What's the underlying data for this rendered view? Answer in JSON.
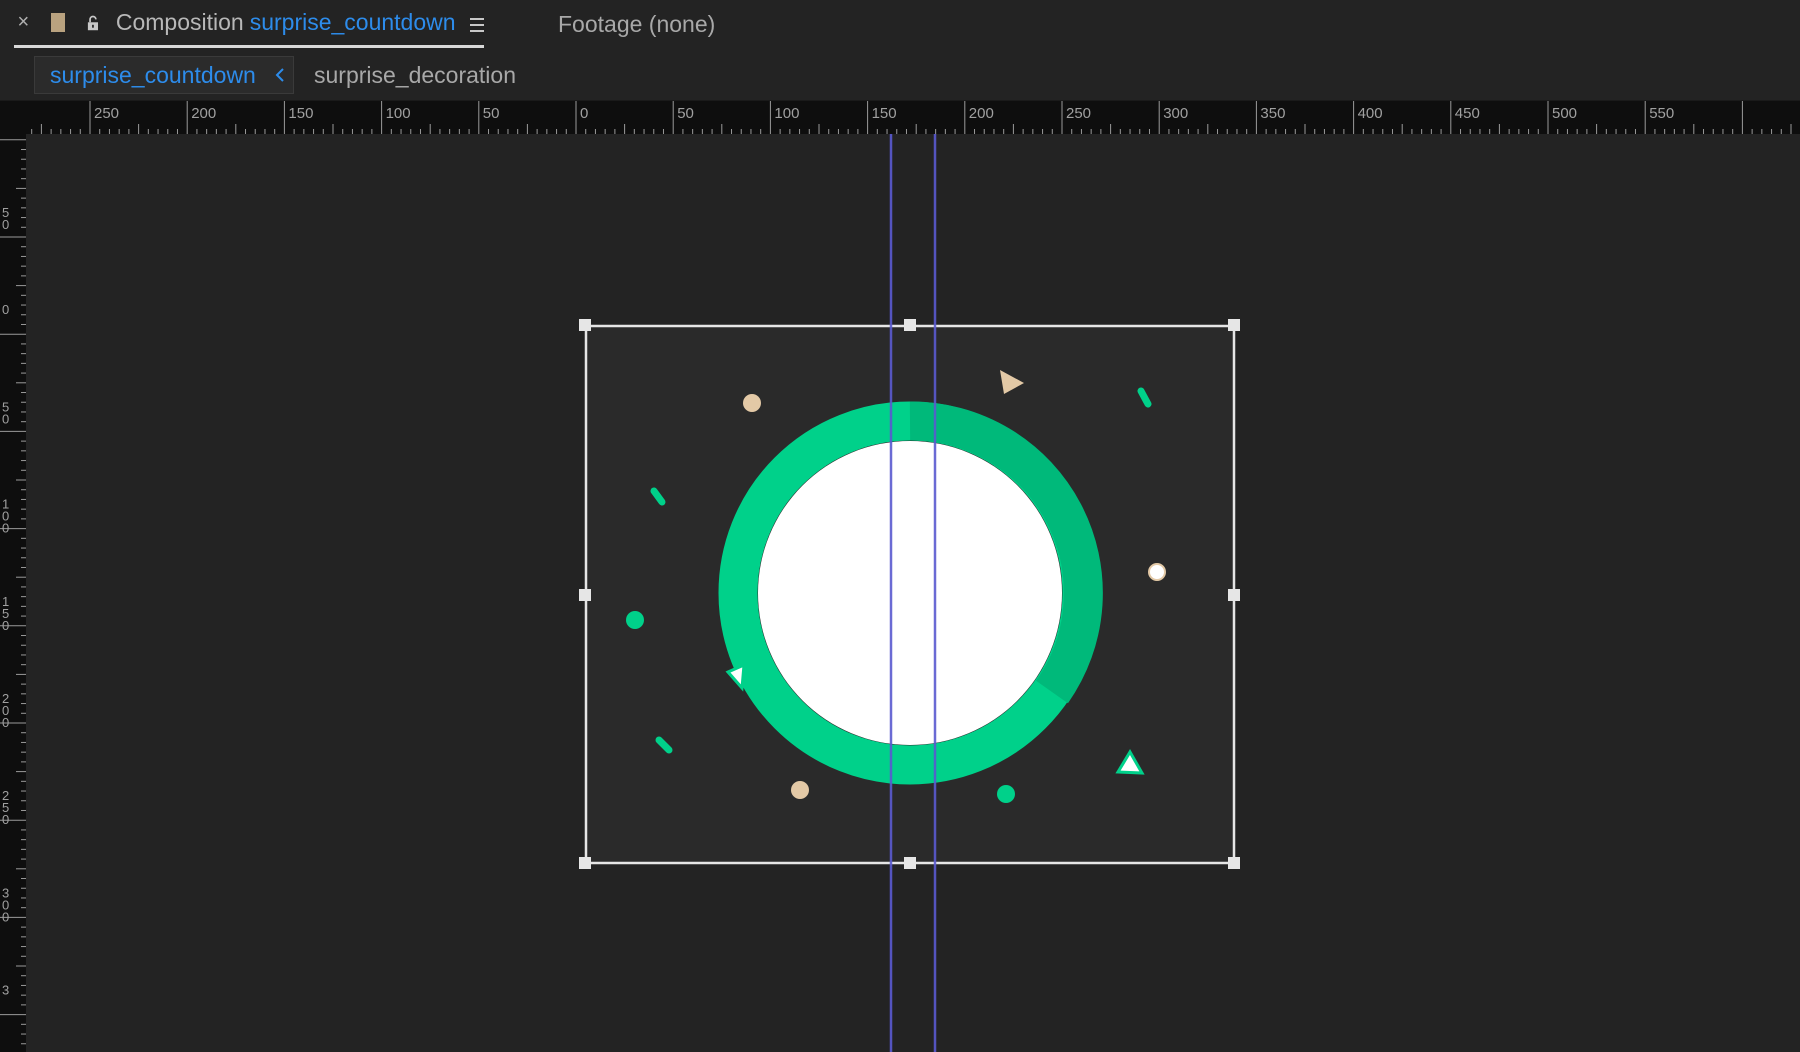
{
  "panel": {
    "close_glyph": "×",
    "composition_tab": {
      "prefix": "Composition",
      "name": "surprise_countdown",
      "swatch_color": "#b9a27f",
      "lock_icon": "lock-open-icon",
      "menu_icon": "hamburger-icon"
    },
    "footage_tab": {
      "label": "Footage (none)"
    }
  },
  "breadcrumbs": {
    "active": "surprise_countdown",
    "arrow_icon": "chevron-left-icon",
    "next": "surprise_decoration"
  },
  "ruler": {
    "horizontal_labels": [
      "250",
      "200",
      "150",
      "100",
      "50",
      "0",
      "50",
      "100",
      "150",
      "200",
      "250",
      "300",
      "350",
      "400",
      "450",
      "500",
      "550"
    ],
    "vertical_labels": [
      [
        "5",
        "0"
      ],
      [
        "0"
      ],
      [
        "5",
        "0"
      ],
      [
        "1",
        "0",
        "0"
      ],
      [
        "1",
        "5",
        "0"
      ],
      [
        "2",
        "0",
        "0"
      ],
      [
        "2",
        "5",
        "0"
      ],
      [
        "3",
        "0",
        "0"
      ],
      [
        "3"
      ]
    ]
  },
  "colors": {
    "accent_blue": "#2d8ceb",
    "ring_green": "#00d18a",
    "ring_green_dark": "#00b97a",
    "confetti_tan": "#e3c9a6",
    "guide_line": "#5a5ad0"
  }
}
